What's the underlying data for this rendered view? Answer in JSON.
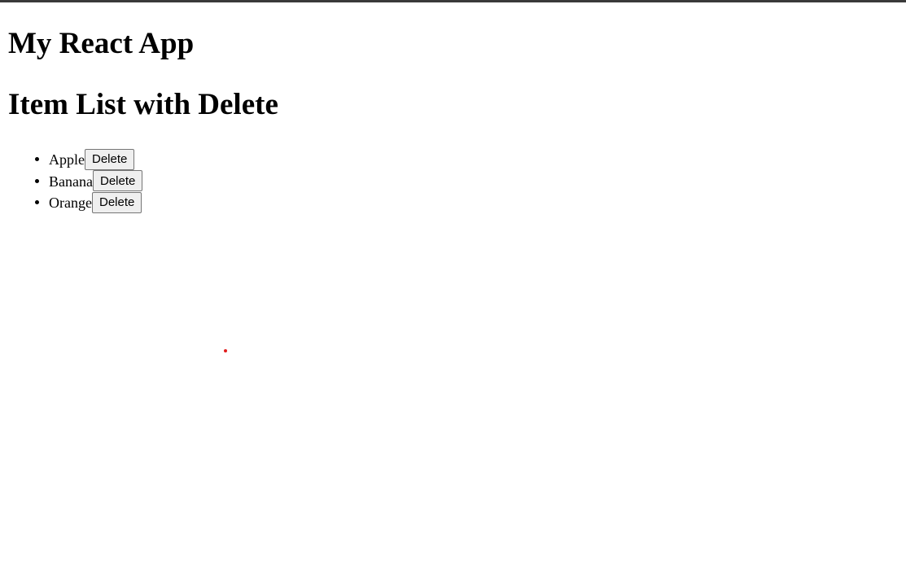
{
  "app": {
    "title": "My React App"
  },
  "list": {
    "heading": "Item List with Delete",
    "items": [
      {
        "label": "Apple",
        "delete_label": "Delete"
      },
      {
        "label": "Banana",
        "delete_label": "Delete"
      },
      {
        "label": "Orange",
        "delete_label": "Delete"
      }
    ]
  },
  "colors": {
    "cursor_marker": "#e11d1d",
    "top_border": "#3a3a3a"
  }
}
